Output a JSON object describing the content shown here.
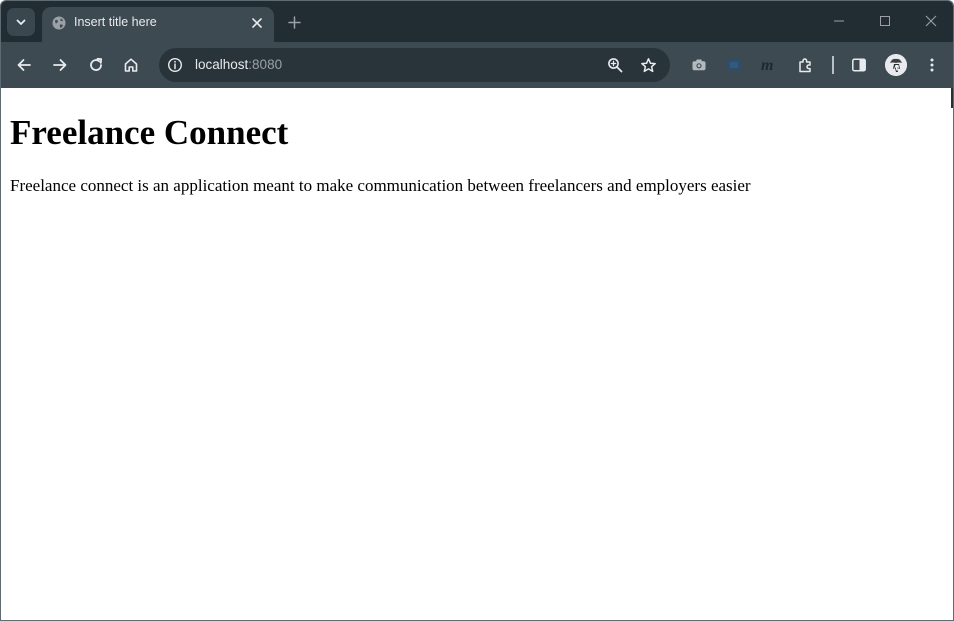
{
  "browser": {
    "tab": {
      "title": "Insert title here",
      "favicon": "globe-icon"
    },
    "address_bar": {
      "host": "localhost",
      "port": ":8080"
    },
    "icons": {
      "tab_search": "chevron-down-icon",
      "close_tab": "close-icon",
      "new_tab": "plus-icon",
      "minimize": "minimize-icon",
      "maximize": "maximize-icon",
      "close_window": "close-icon",
      "back": "arrow-left-icon",
      "forward": "arrow-right-icon",
      "reload": "reload-icon",
      "home": "home-icon",
      "site_info": "info-icon",
      "zoom": "zoom-icon",
      "bookmark": "star-icon",
      "extensions": [
        "camera-extension-icon",
        "blue-extension-icon",
        "m-extension-icon",
        "puzzle-icon"
      ],
      "side_panel": "side-panel-icon",
      "profile": "avatar",
      "menu": "more-vertical-icon"
    },
    "colors": {
      "tabstrip_bg": "#212d33",
      "toolbar_bg": "#3d4a51",
      "omnibox_bg": "#28343a"
    }
  },
  "page": {
    "heading": "Freelance Connect",
    "description": "Freelance connect is an application meant to make communication between freelancers and employers easier"
  }
}
